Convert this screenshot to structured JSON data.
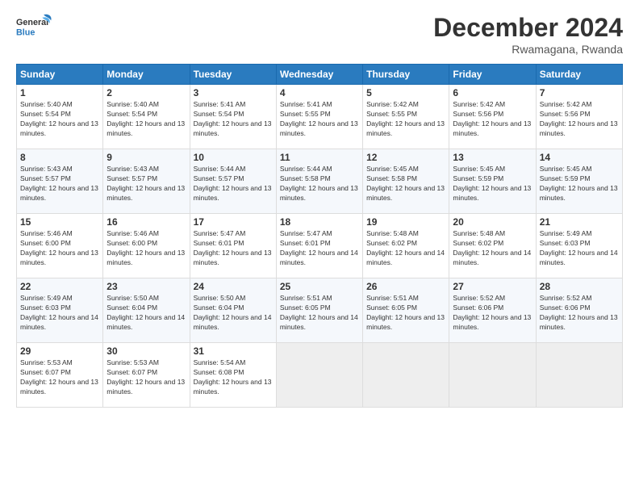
{
  "header": {
    "logo_general": "General",
    "logo_blue": "Blue",
    "month_title": "December 2024",
    "subtitle": "Rwamagana, Rwanda"
  },
  "days_of_week": [
    "Sunday",
    "Monday",
    "Tuesday",
    "Wednesday",
    "Thursday",
    "Friday",
    "Saturday"
  ],
  "weeks": [
    [
      {
        "day": "1",
        "sunrise": "5:40 AM",
        "sunset": "5:54 PM",
        "daylight": "12 hours and 13 minutes."
      },
      {
        "day": "2",
        "sunrise": "5:40 AM",
        "sunset": "5:54 PM",
        "daylight": "12 hours and 13 minutes."
      },
      {
        "day": "3",
        "sunrise": "5:41 AM",
        "sunset": "5:54 PM",
        "daylight": "12 hours and 13 minutes."
      },
      {
        "day": "4",
        "sunrise": "5:41 AM",
        "sunset": "5:55 PM",
        "daylight": "12 hours and 13 minutes."
      },
      {
        "day": "5",
        "sunrise": "5:42 AM",
        "sunset": "5:55 PM",
        "daylight": "12 hours and 13 minutes."
      },
      {
        "day": "6",
        "sunrise": "5:42 AM",
        "sunset": "5:56 PM",
        "daylight": "12 hours and 13 minutes."
      },
      {
        "day": "7",
        "sunrise": "5:42 AM",
        "sunset": "5:56 PM",
        "daylight": "12 hours and 13 minutes."
      }
    ],
    [
      {
        "day": "8",
        "sunrise": "5:43 AM",
        "sunset": "5:57 PM",
        "daylight": "12 hours and 13 minutes."
      },
      {
        "day": "9",
        "sunrise": "5:43 AM",
        "sunset": "5:57 PM",
        "daylight": "12 hours and 13 minutes."
      },
      {
        "day": "10",
        "sunrise": "5:44 AM",
        "sunset": "5:57 PM",
        "daylight": "12 hours and 13 minutes."
      },
      {
        "day": "11",
        "sunrise": "5:44 AM",
        "sunset": "5:58 PM",
        "daylight": "12 hours and 13 minutes."
      },
      {
        "day": "12",
        "sunrise": "5:45 AM",
        "sunset": "5:58 PM",
        "daylight": "12 hours and 13 minutes."
      },
      {
        "day": "13",
        "sunrise": "5:45 AM",
        "sunset": "5:59 PM",
        "daylight": "12 hours and 13 minutes."
      },
      {
        "day": "14",
        "sunrise": "5:45 AM",
        "sunset": "5:59 PM",
        "daylight": "12 hours and 13 minutes."
      }
    ],
    [
      {
        "day": "15",
        "sunrise": "5:46 AM",
        "sunset": "6:00 PM",
        "daylight": "12 hours and 13 minutes."
      },
      {
        "day": "16",
        "sunrise": "5:46 AM",
        "sunset": "6:00 PM",
        "daylight": "12 hours and 13 minutes."
      },
      {
        "day": "17",
        "sunrise": "5:47 AM",
        "sunset": "6:01 PM",
        "daylight": "12 hours and 13 minutes."
      },
      {
        "day": "18",
        "sunrise": "5:47 AM",
        "sunset": "6:01 PM",
        "daylight": "12 hours and 14 minutes."
      },
      {
        "day": "19",
        "sunrise": "5:48 AM",
        "sunset": "6:02 PM",
        "daylight": "12 hours and 14 minutes."
      },
      {
        "day": "20",
        "sunrise": "5:48 AM",
        "sunset": "6:02 PM",
        "daylight": "12 hours and 14 minutes."
      },
      {
        "day": "21",
        "sunrise": "5:49 AM",
        "sunset": "6:03 PM",
        "daylight": "12 hours and 14 minutes."
      }
    ],
    [
      {
        "day": "22",
        "sunrise": "5:49 AM",
        "sunset": "6:03 PM",
        "daylight": "12 hours and 14 minutes."
      },
      {
        "day": "23",
        "sunrise": "5:50 AM",
        "sunset": "6:04 PM",
        "daylight": "12 hours and 14 minutes."
      },
      {
        "day": "24",
        "sunrise": "5:50 AM",
        "sunset": "6:04 PM",
        "daylight": "12 hours and 14 minutes."
      },
      {
        "day": "25",
        "sunrise": "5:51 AM",
        "sunset": "6:05 PM",
        "daylight": "12 hours and 14 minutes."
      },
      {
        "day": "26",
        "sunrise": "5:51 AM",
        "sunset": "6:05 PM",
        "daylight": "12 hours and 13 minutes."
      },
      {
        "day": "27",
        "sunrise": "5:52 AM",
        "sunset": "6:06 PM",
        "daylight": "12 hours and 13 minutes."
      },
      {
        "day": "28",
        "sunrise": "5:52 AM",
        "sunset": "6:06 PM",
        "daylight": "12 hours and 13 minutes."
      }
    ],
    [
      {
        "day": "29",
        "sunrise": "5:53 AM",
        "sunset": "6:07 PM",
        "daylight": "12 hours and 13 minutes."
      },
      {
        "day": "30",
        "sunrise": "5:53 AM",
        "sunset": "6:07 PM",
        "daylight": "12 hours and 13 minutes."
      },
      {
        "day": "31",
        "sunrise": "5:54 AM",
        "sunset": "6:08 PM",
        "daylight": "12 hours and 13 minutes."
      },
      null,
      null,
      null,
      null
    ]
  ],
  "labels": {
    "sunrise_prefix": "Sunrise: ",
    "sunset_prefix": "Sunset: ",
    "daylight_prefix": "Daylight: "
  }
}
